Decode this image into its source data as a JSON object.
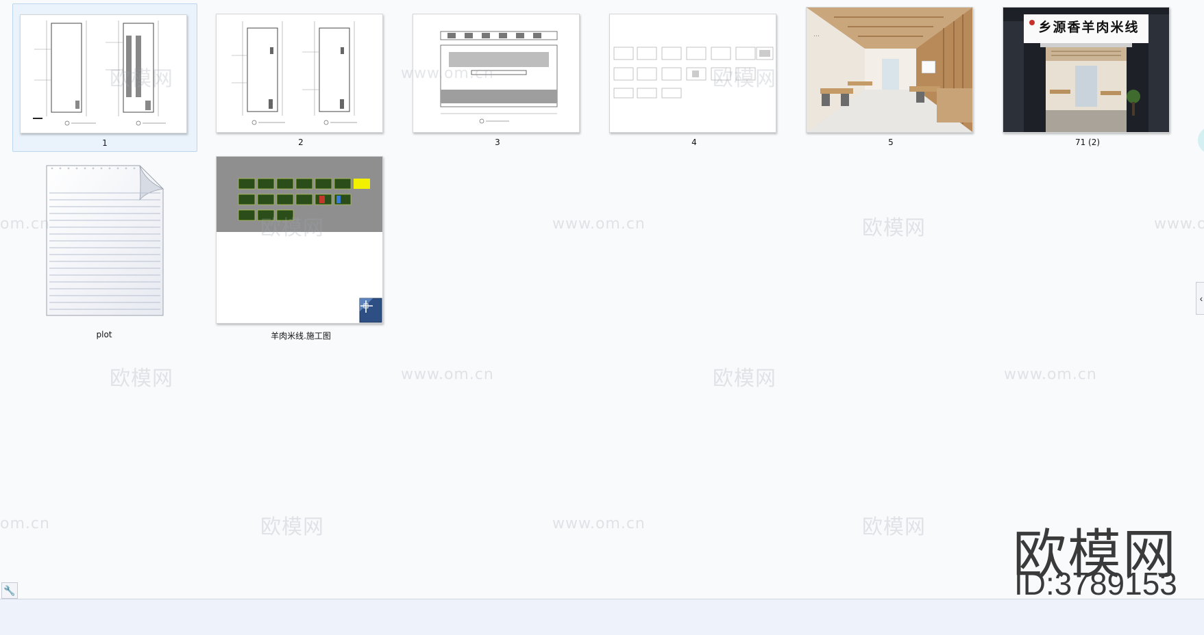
{
  "files": [
    {
      "name": "1",
      "kind": "floor-plan"
    },
    {
      "name": "2",
      "kind": "floor-plan"
    },
    {
      "name": "3",
      "kind": "elevation"
    },
    {
      "name": "4",
      "kind": "detail-sheet"
    },
    {
      "name": "5",
      "kind": "interior-render"
    },
    {
      "name": "71 (2)",
      "kind": "storefront-render"
    },
    {
      "name": "plot",
      "kind": "text-document"
    },
    {
      "name": "羊肉米线.施工图",
      "kind": "cad-drawing"
    }
  ],
  "storefront_sign": "乡源香羊肉米线",
  "watermarks": {
    "site": "欧模网",
    "url": "www.om.cn",
    "url_partial": "om.cn"
  },
  "brand": {
    "name": "欧模网",
    "id": "ID:3789153"
  },
  "colors": {
    "selection": "#eaf3fc",
    "cad_yellow": "#f2f200",
    "cad_green": "#2a4d1a"
  }
}
